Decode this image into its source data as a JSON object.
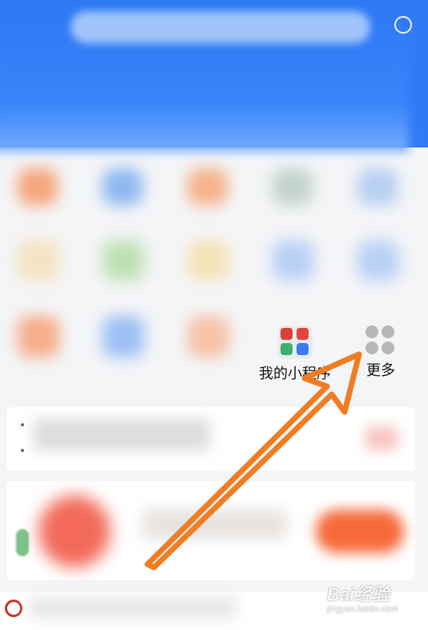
{
  "mini_programs": {
    "my_label": "我的小程序",
    "more_label": "更多"
  },
  "watermark": {
    "main": "Bai经验",
    "sub": "jingyan.baidu.com"
  },
  "colors": {
    "header": "#2f7bf5",
    "arrow": "#f07d24",
    "more_dots": "#b7b7b7"
  },
  "icons": {
    "my_mini_programs": "mini-program-grid-icon",
    "more": "four-dots-icon",
    "scan": "scan-icon"
  }
}
